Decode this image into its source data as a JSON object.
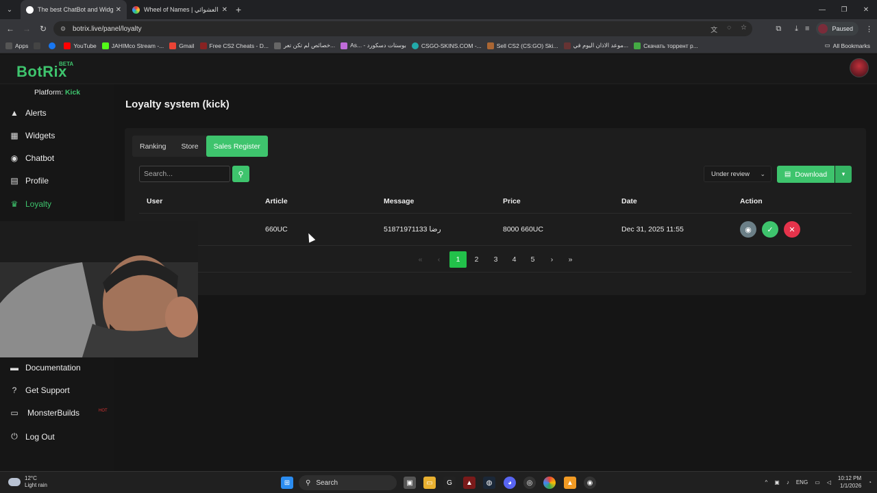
{
  "browser": {
    "tabs": [
      {
        "title": "The best ChatBot and Widgets",
        "active": true
      },
      {
        "title": "Wheel of Names | اسم العشوائي",
        "active": false
      }
    ],
    "url": "botrix.live/panel/loyalty",
    "profile_status": "Paused",
    "bookmarks": [
      "Apps",
      "YouTube",
      "JAHIMco Stream -...",
      "Gmail",
      "Free CS2 Cheats - D...",
      "خصائص لم تكن تعر...",
      "As... - بوستات دسكورد",
      "CSGO-SKINS.COM -...",
      "Sell CS2 (CS:GO) Ski...",
      "موعد الاذان اليوم في...",
      "Скачать торрент р..."
    ],
    "all_bookmarks": "All Bookmarks"
  },
  "app": {
    "logo": "BotRix",
    "badge": "BETA",
    "platform_label": "Platform:",
    "platform_value": "Kick"
  },
  "sidebar": {
    "items": [
      {
        "label": "Alerts",
        "icon": "warning-icon"
      },
      {
        "label": "Widgets",
        "icon": "widgets-icon"
      },
      {
        "label": "Chatbot",
        "icon": "robot-icon"
      },
      {
        "label": "Profile",
        "icon": "profile-card-icon"
      },
      {
        "label": "Loyalty",
        "icon": "trophy-icon",
        "active": true
      }
    ],
    "bottom_items": [
      {
        "label": "Documentation",
        "icon": "book-icon"
      },
      {
        "label": "Get Support",
        "icon": "help-icon"
      },
      {
        "label": "MonsterBuilds",
        "icon": "laptop-icon"
      },
      {
        "label": "Log Out",
        "icon": "logout-icon"
      }
    ],
    "hot_badge": "HOT"
  },
  "page": {
    "title": "Loyalty system (kick)",
    "tabs": [
      "Ranking",
      "Store",
      "Sales Register"
    ],
    "active_tab": "Sales Register",
    "search_placeholder": "Search...",
    "filter_selected": "Under review",
    "download_label": "Download",
    "table": {
      "headers": [
        "User",
        "Article",
        "Message",
        "Price",
        "Date",
        "Action"
      ],
      "rows": [
        {
          "user": "",
          "article": "660UC",
          "message": "رضا 51871971133",
          "price": "8000 660UC",
          "date": "Dec 31, 2025 11:55"
        }
      ]
    },
    "pagination": {
      "pages": [
        "1",
        "2",
        "3",
        "4",
        "5"
      ],
      "current": "1"
    }
  },
  "taskbar": {
    "temp": "12°C",
    "weather": "Light rain",
    "search": "Search",
    "lang": "ENG",
    "time": "10:12 PM",
    "date": "1/1/2026"
  },
  "colors": {
    "accent": "#3ec46d",
    "danger": "#e5334b",
    "view": "#6b7f87"
  }
}
